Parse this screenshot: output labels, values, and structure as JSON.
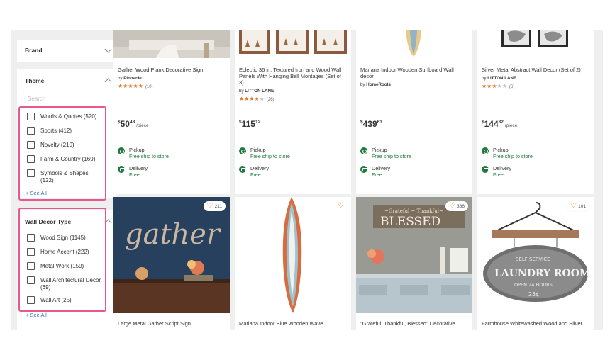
{
  "sidebar": {
    "brand": {
      "title": "Brand"
    },
    "theme": {
      "title": "Theme",
      "search_placeholder": "Search",
      "options": [
        {
          "label": "Words & Quotes (520)"
        },
        {
          "label": "Sports (412)"
        },
        {
          "label": "Novelty (210)"
        },
        {
          "label": "Farm & Country (169)"
        },
        {
          "label": "Symbols & Shapes (122)"
        }
      ],
      "see_all": "+ See All"
    },
    "wall_decor_type": {
      "title": "Wall Decor Type",
      "options": [
        {
          "label": "Wood Sign (1145)"
        },
        {
          "label": "Home Accent (222)"
        },
        {
          "label": "Metal Work (159)"
        },
        {
          "label": "Wall Architectural Decor (69)"
        },
        {
          "label": "Wall Art (25)"
        }
      ],
      "see_all": "+ See All"
    }
  },
  "products_row1": [
    {
      "title": "Gather Wood Plank Decorative Sign",
      "brand_prefix": "by",
      "brand": "Pinnacle",
      "rating": 5,
      "review_count": "(10)",
      "price_dollars": "50",
      "price_cents": "48",
      "price_unit": "/piece",
      "pickup_title": "Pickup",
      "pickup_sub": "Free ship to store",
      "delivery_title": "Delivery",
      "delivery_sub": "Free"
    },
    {
      "title": "Eclectic 36 in. Textured Iron and Wood Wall Panels With Hanging Bell Montages (Set of 3)",
      "brand_prefix": "by",
      "brand": "LITTON LANE",
      "rating": 4,
      "review_count": "(26)",
      "price_dollars": "115",
      "price_cents": "12",
      "price_unit": "",
      "pickup_title": "Pickup",
      "pickup_sub": "Free ship to store",
      "delivery_title": "Delivery",
      "delivery_sub": "Free"
    },
    {
      "title": "Mariana Indoor Wooden Surfboard Wall decor",
      "brand_prefix": "by",
      "brand": "HomeRoots",
      "rating": 0,
      "review_count": "",
      "price_dollars": "439",
      "price_cents": "63",
      "price_unit": "",
      "pickup_title": "Pickup",
      "pickup_sub": "Free ship to store",
      "delivery_title": "Delivery",
      "delivery_sub": "Free"
    },
    {
      "title": "Silver Metal Abstract Wall Decor (Set of 2)",
      "brand_prefix": "by",
      "brand": "LITTON LANE",
      "rating": 3.5,
      "review_count": "(6)",
      "price_dollars": "144",
      "price_cents": "32",
      "price_unit": "/piece",
      "pickup_title": "Pickup",
      "pickup_sub": "Free ship to store",
      "delivery_title": "Delivery",
      "delivery_sub": "Free"
    }
  ],
  "products_row2": [
    {
      "title": "Large Metal Gather Script Sign",
      "fav_count": "211"
    },
    {
      "title": "Mariana Indoor Blue Wooden Wave",
      "fav_count": ""
    },
    {
      "title": "\"Grateful, Thankful, Blessed\" Decorative",
      "fav_count": "386"
    },
    {
      "title": "Farmhouse Whitewashed Wood and Silver",
      "fav_count": "101"
    }
  ],
  "image_text": {
    "gather_script": "gather",
    "blessed_small": "~Grateful ~ Thankful~",
    "blessed_big": "BLESSED",
    "laundry_top": "SELF SERVICE",
    "laundry_main": "LAUNDRY ROOM",
    "laundry_sub": "OPEN 24 HOURS",
    "laundry_price": "25¢"
  },
  "colors": {
    "accent_orange": "#e37222",
    "link_blue": "#2a6ebb",
    "green": "#1f7a3f",
    "highlight_pink": "#e8588a"
  }
}
